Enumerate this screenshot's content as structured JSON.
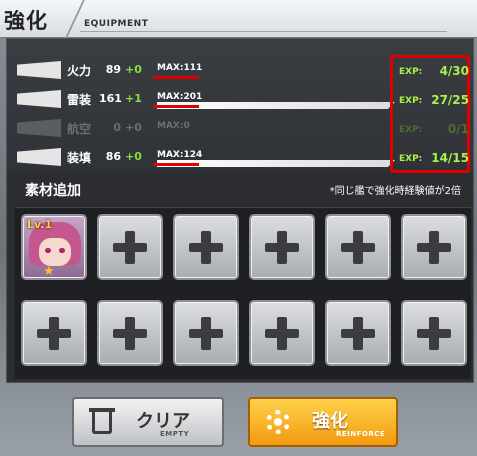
{
  "header": {
    "title": "強化",
    "subtitle": "EQUIPMENT"
  },
  "stats": [
    {
      "name": "火力",
      "value": "89",
      "plus": "+0",
      "max": "MAX:111",
      "exp_label": "EXP:",
      "exp": "4/30",
      "icon": "firepower-icon",
      "enabled": true,
      "fill": 0.0
    },
    {
      "name": "雷装",
      "value": "161",
      "plus": "+1",
      "max": "MAX:201",
      "exp_label": "EXP:",
      "exp": "27/25",
      "icon": "torpedo-icon",
      "enabled": true,
      "fill": 1.0
    },
    {
      "name": "航空",
      "value": "0",
      "plus": "+0",
      "max": "MAX:0",
      "exp_label": "EXP:",
      "exp": "0/1",
      "icon": "aircraft-icon",
      "enabled": false,
      "fill": 0.0
    },
    {
      "name": "装填",
      "value": "86",
      "plus": "+0",
      "max": "MAX:124",
      "exp_label": "EXP:",
      "exp": "14/15",
      "icon": "reload-icon",
      "enabled": true,
      "fill": 1.0
    }
  ],
  "materials": {
    "title": "素材追加",
    "note": "*同じ艦で強化時経験値が2倍",
    "first_level": "Lv.1",
    "slots": 12
  },
  "buttons": {
    "clear": {
      "label": "クリア",
      "sub": "EMPTY"
    },
    "reinforce": {
      "label": "強化",
      "sub": "REINFORCE"
    }
  },
  "colors": {
    "exp_green": "#a8f14a",
    "highlight_red": "#e00000",
    "reinforce_orange": "#f29a0f"
  }
}
